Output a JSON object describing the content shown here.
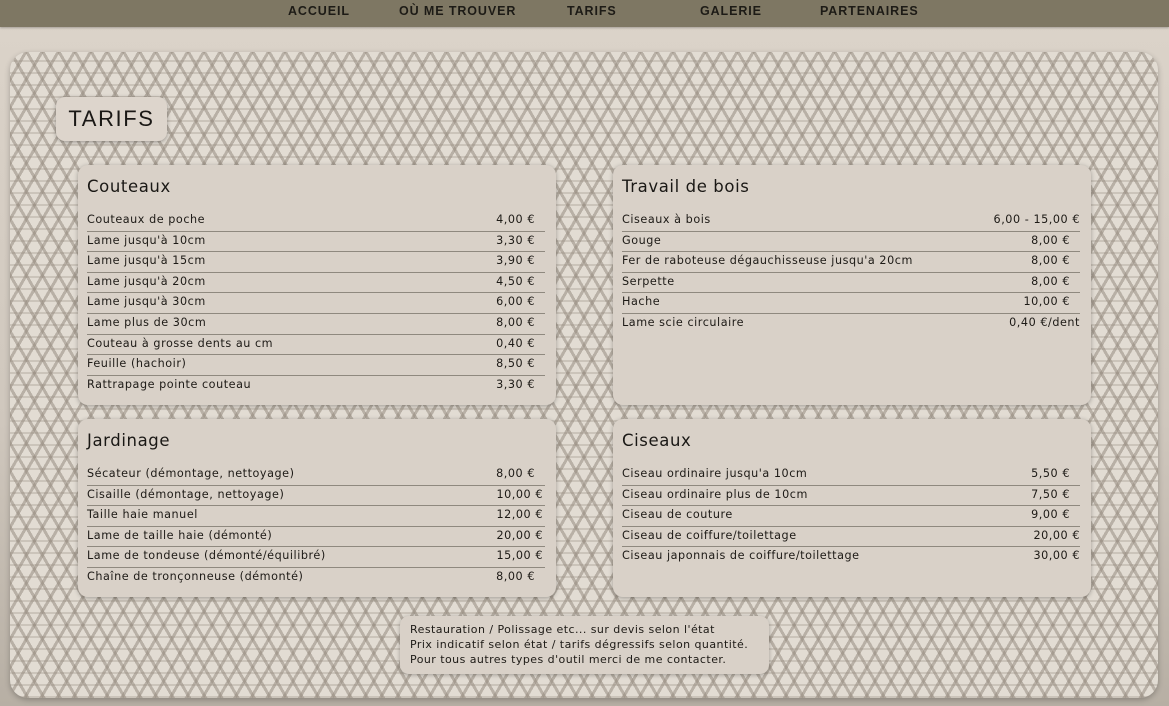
{
  "nav": {
    "items": [
      {
        "label": "ACCUEIL"
      },
      {
        "label": "OÙ ME TROUVER"
      },
      {
        "label": "TARIFS"
      },
      {
        "label": "GALERIE"
      },
      {
        "label": "PARTENAIRES"
      }
    ]
  },
  "page": {
    "title": "TARIFS"
  },
  "sections": {
    "couteaux": {
      "title": "Couteaux",
      "rows": [
        {
          "label": "Couteaux de poche",
          "price": "4,00 €"
        },
        {
          "label": "Lame jusqu'à 10cm",
          "price": "3,30 €"
        },
        {
          "label": "Lame jusqu'à 15cm",
          "price": "3,90 €"
        },
        {
          "label": "Lame jusqu'à 20cm",
          "price": "4,50 €"
        },
        {
          "label": "Lame jusqu'à 30cm",
          "price": "6,00 €"
        },
        {
          "label": "Lame plus de 30cm",
          "price": "8,00 €"
        },
        {
          "label": "Couteau à grosse dents au cm",
          "price": "0,40 €"
        },
        {
          "label": "Feuille (hachoir)",
          "price": "8,50 €"
        },
        {
          "label": "Rattrapage pointe couteau",
          "price": "3,30 €"
        }
      ]
    },
    "bois": {
      "title": "Travail de bois",
      "rows": [
        {
          "label": "Ciseaux à bois",
          "price": "6,00 - 15,00 €"
        },
        {
          "label": "Gouge",
          "price": "8,00 €"
        },
        {
          "label": "Fer de raboteuse dégauchisseuse jusqu'a 20cm",
          "price": "8,00 €"
        },
        {
          "label": "Serpette",
          "price": "8,00 €"
        },
        {
          "label": "Hache",
          "price": "10,00 €"
        },
        {
          "label": "Lame scie circulaire",
          "price": "0,40 €/dent"
        }
      ]
    },
    "jardinage": {
      "title": "Jardinage",
      "rows": [
        {
          "label": "Sécateur (démontage, nettoyage)",
          "price": "8,00 €"
        },
        {
          "label": "Cisaille (démontage, nettoyage)",
          "price": "10,00 €"
        },
        {
          "label": "Taille haie manuel",
          "price": "12,00 €"
        },
        {
          "label": "Lame de taille haie (démonté)",
          "price": "20,00 €"
        },
        {
          "label": "Lame de tondeuse (démonté/équilibré)",
          "price": "15,00 €"
        },
        {
          "label": "Chaîne de tronçonneuse (démonté)",
          "price": "8,00 €"
        }
      ]
    },
    "ciseaux": {
      "title": "Ciseaux",
      "rows": [
        {
          "label": "Ciseau ordinaire jusqu'a 10cm",
          "price": "5,50 €"
        },
        {
          "label": "Ciseau ordinaire plus de 10cm",
          "price": "7,50 €"
        },
        {
          "label": "Ciseau de couture",
          "price": "9,00 €"
        },
        {
          "label": "Ciseau de coiffure/toilettage",
          "price": "20,00 €"
        },
        {
          "label": "Ciseau japonnais de coiffure/toilettage",
          "price": "30,00 €"
        }
      ]
    }
  },
  "notes": {
    "lines": [
      "Restauration / Polissage etc... sur devis selon l'état",
      "Prix indicatif selon état / tarifs dégressifs selon quantité.",
      "Pour tous autres types d'outil merci de me contacter."
    ]
  }
}
